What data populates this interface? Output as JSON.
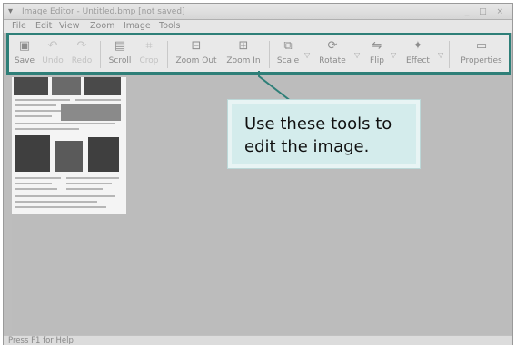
{
  "window": {
    "title": "Image Editor - Untitled.bmp [not saved]",
    "controls": "_ □ ×"
  },
  "menubar": [
    "File",
    "Edit",
    "View",
    "Zoom",
    "Image",
    "Tools"
  ],
  "toolbar": {
    "save": "Save",
    "undo": "Undo",
    "redo": "Redo",
    "scroll": "Scroll",
    "crop": "Crop",
    "zoom_out": "Zoom Out",
    "zoom_in": "Zoom In",
    "scale": "Scale",
    "rotate": "Rotate",
    "flip": "Flip",
    "effect": "Effect",
    "properties": "Properties"
  },
  "callout": {
    "line1": "Use these tools to",
    "line2": "edit the image."
  },
  "status": "Press F1 for Help",
  "colors": {
    "toolbar_border": "#2e7f78",
    "callout_bg": "#d4ecec"
  }
}
